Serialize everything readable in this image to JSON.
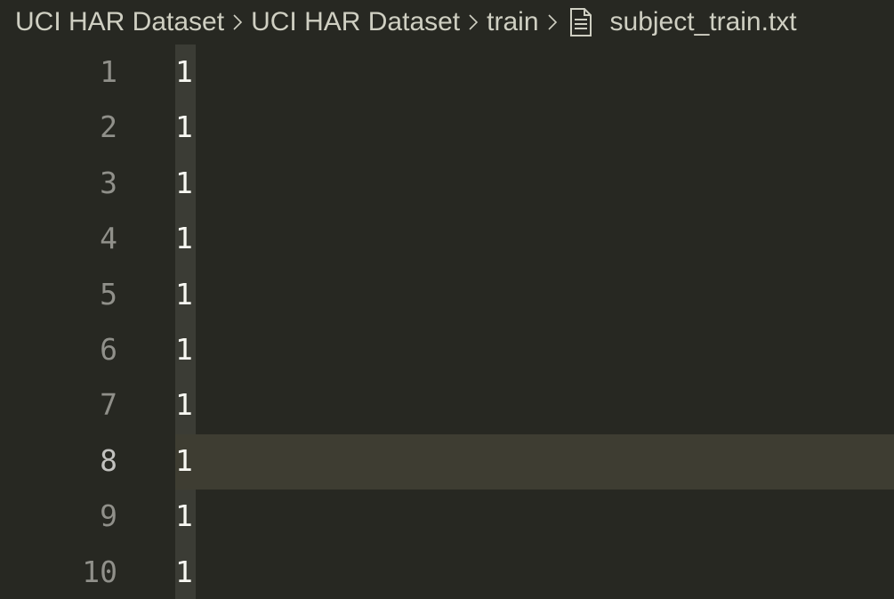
{
  "breadcrumb": {
    "items": [
      "UCI HAR Dataset",
      "UCI HAR Dataset",
      "train"
    ],
    "file_name": "subject_train.txt",
    "file_icon": "file-text-icon",
    "separator_icon": "chevron-right-icon"
  },
  "editor": {
    "active_line": 8,
    "lines": [
      {
        "number": "1",
        "text": "1"
      },
      {
        "number": "2",
        "text": "1"
      },
      {
        "number": "3",
        "text": "1"
      },
      {
        "number": "4",
        "text": "1"
      },
      {
        "number": "5",
        "text": "1"
      },
      {
        "number": "6",
        "text": "1"
      },
      {
        "number": "7",
        "text": "1"
      },
      {
        "number": "8",
        "text": "1"
      },
      {
        "number": "9",
        "text": "1"
      },
      {
        "number": "10",
        "text": "1"
      }
    ]
  },
  "colors": {
    "background": "#272822",
    "current_line": "#3e3d32",
    "text": "#f8f8f2",
    "line_number": "#90908a",
    "breadcrumb_text": "#cfcfc2"
  }
}
